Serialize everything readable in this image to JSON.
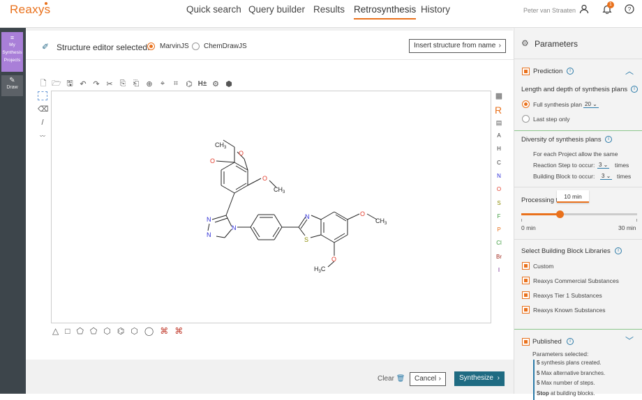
{
  "app": {
    "logo": "Reaxys"
  },
  "nav": {
    "items": [
      "Quick search",
      "Query builder",
      "Results",
      "Retrosynthesis",
      "History"
    ],
    "active": "Retrosynthesis"
  },
  "user": {
    "name": "Peter van Straaten",
    "notifications": "1"
  },
  "sidebar": {
    "projects_label": [
      "My",
      "Synthesis",
      "Projects"
    ],
    "draw_label": "Draw"
  },
  "editor": {
    "title": "Structure editor selected:",
    "options": [
      {
        "label": "MarvinJS",
        "selected": true
      },
      {
        "label": "ChemDrawJS",
        "selected": false
      }
    ],
    "insert_button": "Insert structure from name",
    "atoms": [
      "A",
      "H",
      "C",
      "N",
      "O",
      "S",
      "F",
      "P",
      "Cl",
      "Br",
      "I"
    ],
    "atom_colors": [
      "#333",
      "#333",
      "#333",
      "#2b2bd6",
      "#e23b2b",
      "#8a8a00",
      "#3a9a3a",
      "#e9711c",
      "#3a9a3a",
      "#a0281d",
      "#6a1b8a"
    ],
    "r_label": "R"
  },
  "molecule": {
    "labels": {
      "ch3_a": "CH",
      "ch3_a_sub": "3",
      "o_a": "O",
      "o_b": "O",
      "o_c": "O",
      "ch3_c": "CH",
      "ch3_c_sub": "3",
      "n1": "N",
      "n2": "N",
      "n3": "N",
      "n4": "N",
      "s1": "S",
      "o_d": "O",
      "ch3_d": "CH",
      "ch3_d_sub": "3",
      "o_e": "O",
      "h3c": "H",
      "h3c_sub": "3",
      "h3c_c": "C"
    }
  },
  "footer": {
    "clear": "Clear",
    "cancel": "Cancel",
    "synthesize": "Synthesize"
  },
  "params": {
    "title": "Parameters",
    "prediction": "Prediction",
    "length_title": "Length and depth of synthesis plans",
    "full_plan": "Full synthesis plan",
    "full_plan_value": "20",
    "last_step": "Last step only",
    "diversity_title": "Diversity of synthesis plans",
    "each_project": "For each Project allow the same",
    "reaction_step": "Reaction Step to occur:",
    "reaction_step_value": "3",
    "building_block": "Building Block to occur:",
    "building_block_value": "3",
    "times": "times",
    "processing": "Processing t",
    "tooltip": "10 min",
    "slider_min": "0 min",
    "slider_max": "30 min",
    "slider_value": 0.33,
    "bb_title": "Select Building Block Libraries",
    "libraries": [
      "Custom",
      "Reaxys Commercial Substances",
      "Reaxys Tier 1 Substances",
      "Reaxys Known Substances"
    ],
    "published": "Published",
    "params_selected": "Parameters selected:",
    "selected_items": [
      {
        "bold": "5",
        "text": " synthesis plans created."
      },
      {
        "bold": "5",
        "text": " Max alternative branches."
      },
      {
        "bold": "5",
        "text": " Max number of steps."
      },
      {
        "bold": "Stop",
        "text": " at building blocks."
      }
    ]
  }
}
